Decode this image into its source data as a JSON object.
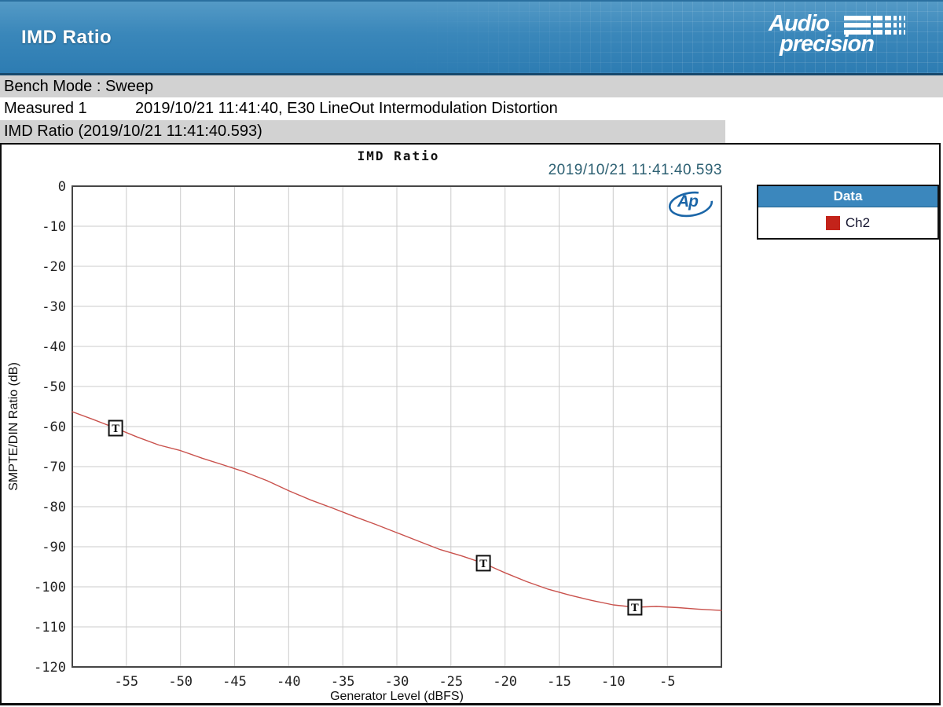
{
  "banner": {
    "title": "IMD Ratio",
    "logo_word1": "Audio",
    "logo_word2": "precision"
  },
  "statusbar": {
    "bench_mode": "Bench Mode : Sweep",
    "measured_label": "Measured 1",
    "measured_value": "2019/10/21 11:41:40, E30 LineOut Intermodulation Distortion",
    "result_title": "IMD Ratio (2019/10/21 11:41:40.593)"
  },
  "chart": {
    "title": "IMD Ratio",
    "timestamp": "2019/10/21 11:41:40.593",
    "ap_monogram": "Ap",
    "legend": {
      "header": "Data",
      "entries": [
        {
          "label": "Ch2",
          "color": "#c3231a"
        }
      ]
    }
  },
  "colors": {
    "banner_blue": "#3a87ba",
    "legend_header_blue": "#3b87bd",
    "trace_red": "#c9514c",
    "swatch_red": "#c3231a",
    "timestamp_teal": "#2e6173",
    "bar_gray": "#d2d2d2"
  },
  "chart_data": {
    "type": "line",
    "title": "IMD Ratio",
    "xlabel": "Generator Level (dBFS)",
    "ylabel": "SMPTE/DIN Ratio (dB)",
    "xlim": [
      -60,
      0
    ],
    "ylim": [
      -120,
      0
    ],
    "x_ticks": [
      -55,
      -50,
      -45,
      -40,
      -35,
      -30,
      -25,
      -20,
      -15,
      -10,
      -5
    ],
    "y_ticks": [
      0,
      -10,
      -20,
      -30,
      -40,
      -50,
      -60,
      -70,
      -80,
      -90,
      -100,
      -110,
      -120
    ],
    "grid": true,
    "legend_position": "outside-top-right",
    "series": [
      {
        "name": "Ch2",
        "color": "#c9514c",
        "x": [
          -60,
          -58,
          -56,
          -54,
          -52,
          -50,
          -48,
          -46,
          -44,
          -42,
          -40,
          -38,
          -36,
          -34,
          -32,
          -30,
          -28,
          -26,
          -24,
          -22,
          -20,
          -18,
          -16,
          -14,
          -12,
          -10,
          -8,
          -6,
          -4,
          -2,
          0
        ],
        "y": [
          -56.3,
          -58.3,
          -60.4,
          -62.6,
          -64.6,
          -66.0,
          -67.9,
          -69.6,
          -71.4,
          -73.5,
          -76.0,
          -78.3,
          -80.3,
          -82.4,
          -84.4,
          -86.5,
          -88.6,
          -90.7,
          -92.3,
          -94.1,
          -96.5,
          -98.7,
          -100.6,
          -102.1,
          -103.4,
          -104.5,
          -105.1,
          -104.9,
          -105.2,
          -105.6,
          -105.9
        ]
      }
    ],
    "markers": {
      "symbol": "T",
      "points": [
        [
          -56,
          -60.4
        ],
        [
          -22,
          -94.1
        ],
        [
          -8,
          -105.1
        ]
      ]
    }
  }
}
